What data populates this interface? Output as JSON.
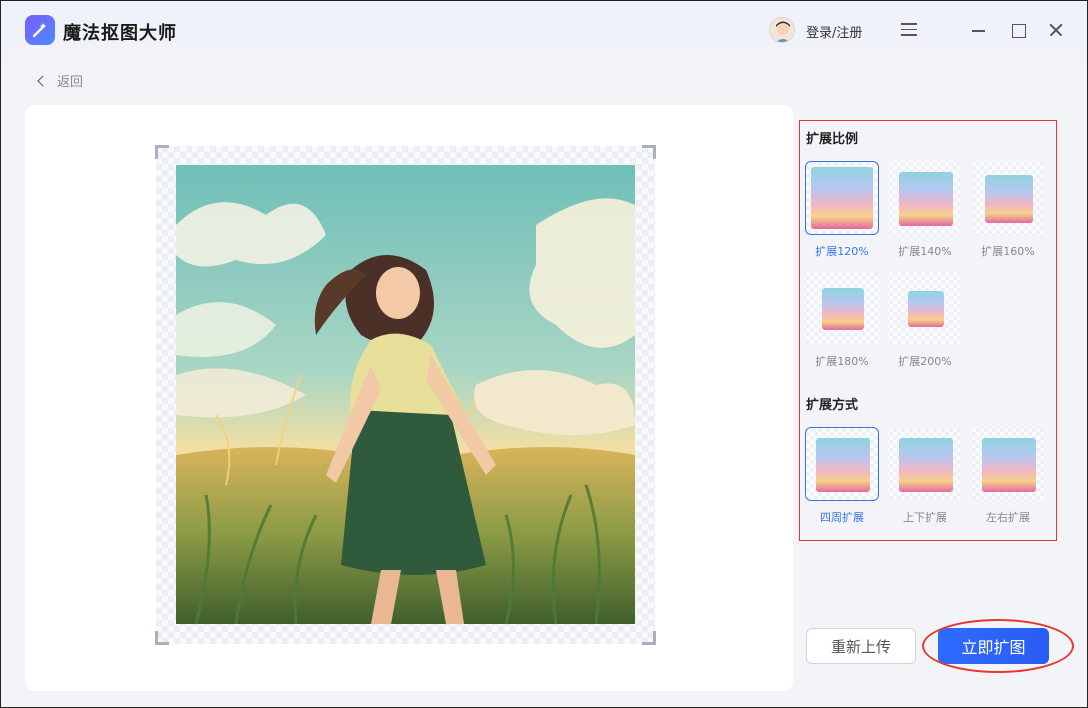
{
  "app": {
    "title": "魔法抠图大师",
    "login": "登录/注册"
  },
  "nav": {
    "back_label": "返回"
  },
  "panel": {
    "ratio_title": "扩展比例",
    "ratios": [
      {
        "label": "扩展120%",
        "selected": true
      },
      {
        "label": "扩展140%",
        "selected": false
      },
      {
        "label": "扩展160%",
        "selected": false
      },
      {
        "label": "扩展180%",
        "selected": false
      },
      {
        "label": "扩展200%",
        "selected": false
      }
    ],
    "mode_title": "扩展方式",
    "modes": [
      {
        "label": "四周扩展",
        "selected": true
      },
      {
        "label": "上下扩展",
        "selected": false
      },
      {
        "label": "左右扩展",
        "selected": false
      }
    ]
  },
  "actions": {
    "reupload": "重新上传",
    "expand": "立即扩图"
  },
  "colors": {
    "accent": "#2f6bff",
    "highlight": "#e5392e"
  }
}
